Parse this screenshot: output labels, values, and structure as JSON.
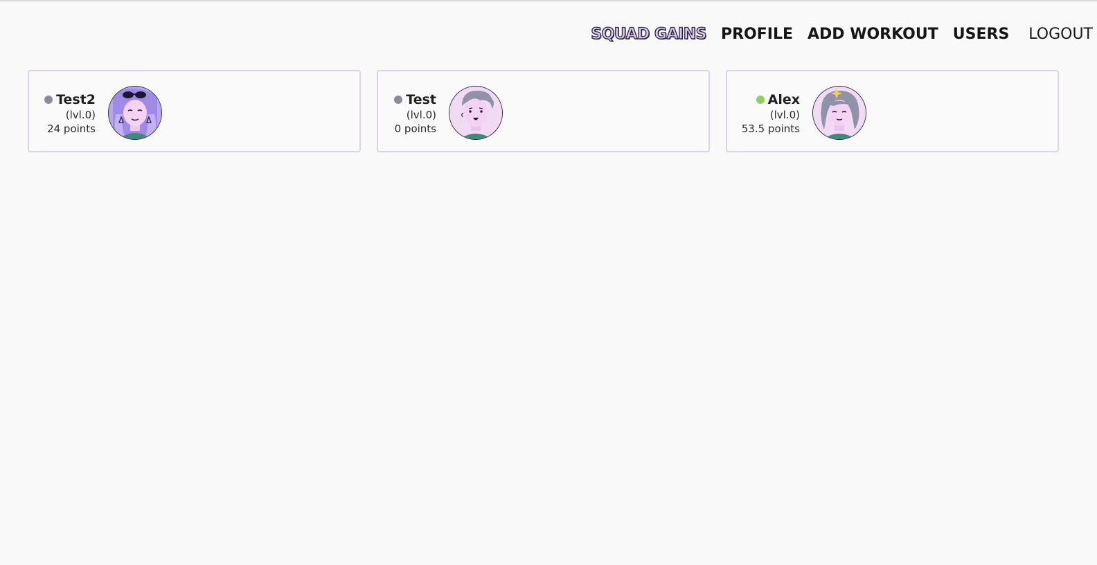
{
  "nav": {
    "brand": "SQUAD GAINS",
    "items": [
      {
        "label": "PROFILE"
      },
      {
        "label": "ADD WORKOUT"
      },
      {
        "label": "USERS"
      }
    ],
    "logout": "LOGOUT"
  },
  "users": [
    {
      "name": "Test2",
      "level": "(lvl.0)",
      "points": "24 points",
      "status": "offline",
      "status_color": "#8e8a9c",
      "avatar": "avatar-sunglasses-woman"
    },
    {
      "name": "Test",
      "level": "(lvl.0)",
      "points": "0 points",
      "status": "offline",
      "status_color": "#8e8a9c",
      "avatar": "avatar-smiling-man"
    },
    {
      "name": "Alex",
      "level": "(lvl.0)",
      "points": "53.5 points",
      "status": "online",
      "status_color": "#92d05c",
      "avatar": "avatar-sparkle-woman"
    }
  ],
  "colors": {
    "card_border": "#dcd1f0",
    "avatar_bg": "#efd8f3",
    "brand_fill": "#d9c8f2"
  }
}
